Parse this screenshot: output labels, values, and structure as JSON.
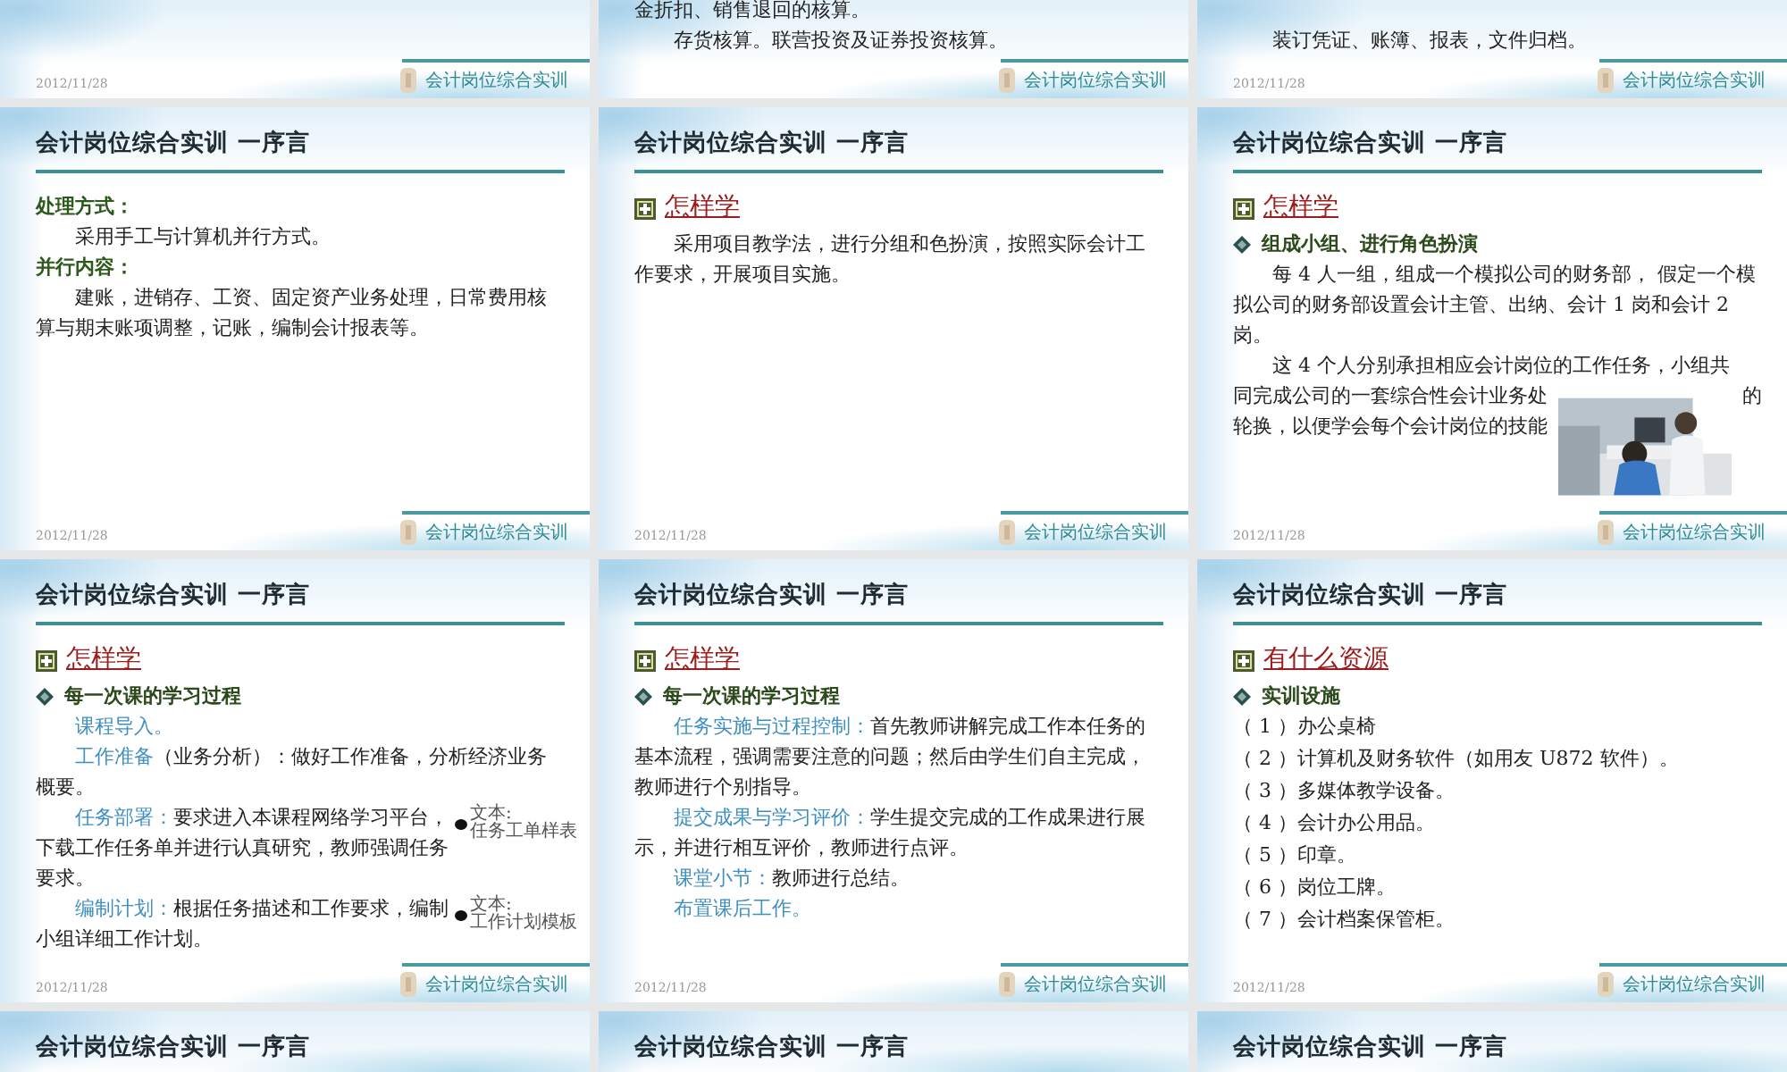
{
  "slides": [
    {
      "kind": "tail",
      "date": "2012/11/28",
      "footer": "会计岗位综合实训"
    },
    {
      "kind": "tail",
      "items": [
        {
          "kind": "para",
          "indent": false,
          "text": "金折扣、销售退回的核算。"
        },
        {
          "kind": "para",
          "indent": true,
          "text": "存货核算。联营投资及证券投资核算。"
        }
      ],
      "footer": "会计岗位综合实训"
    },
    {
      "kind": "tail",
      "items": [
        {
          "kind": "para",
          "indent": true,
          "text": "装订凭证、账簿、报表，文件归档。"
        }
      ],
      "date": "2012/11/28",
      "footer": "会计岗位综合实训"
    },
    {
      "kind": "full",
      "title": "会计岗位综合实训 一序言",
      "items": [
        {
          "kind": "label",
          "text": "处理方式："
        },
        {
          "kind": "para",
          "indent": true,
          "text": "采用手工与计算机并行方式。"
        },
        {
          "kind": "label",
          "text": "并行内容："
        },
        {
          "kind": "para",
          "indent": true,
          "text": "建账，进销存、工资、固定资产业务处理，日常费用核算与期末账项调整，记账，编制会计报表等。"
        }
      ],
      "date": "2012/11/28",
      "footer": "会计岗位综合实训"
    },
    {
      "kind": "full",
      "title": "会计岗位综合实训 一序言",
      "items": [
        {
          "kind": "heading",
          "text": "怎样学"
        },
        {
          "kind": "para",
          "indent": true,
          "text": "采用项目教学法，进行分组和色扮演，按照实际会计工作要求，开展项目实施。"
        }
      ],
      "date": "2012/11/28",
      "footer": "会计岗位综合实训"
    },
    {
      "kind": "full",
      "title": "会计岗位综合实训 一序言",
      "items": [
        {
          "kind": "heading",
          "text": "怎样学"
        },
        {
          "kind": "subheading",
          "text": "组成小组、进行角色扮演"
        },
        {
          "kind": "para",
          "indent": true,
          "text": "每 4 人一组，组成一个模拟公司的财务部， 假定一个模拟公司的财务部设置会计主管、出纳、会计 1 岗和会计 2 岗。"
        },
        {
          "kind": "lines",
          "lines": [
            {
              "indent": true,
              "text": "这 4 个人分别承担相应会计岗位的工作任务，小组共"
            },
            {
              "indent": false,
              "text": "同完成公司的一套综合性会计业务处",
              "tail": "的"
            },
            {
              "indent": false,
              "text": "轮换，以便学会每个会计岗位的技能"
            }
          ]
        }
      ],
      "date": "2012/11/28",
      "footer": "会计岗位综合实训"
    },
    {
      "kind": "full",
      "title": "会计岗位综合实训 一序言",
      "items": [
        {
          "kind": "heading",
          "text": "怎样学"
        },
        {
          "kind": "subheading",
          "text": "每一次课的学习过程"
        },
        {
          "kind": "para",
          "indent": true,
          "label": "课程导入。"
        },
        {
          "kind": "para",
          "indent": true,
          "label": "工作准备",
          "text": "（业务分析）：做好工作准备，分析经济业务概要。"
        },
        {
          "kind": "para",
          "indent": true,
          "label": "任务部署：",
          "text": "要求进入本课程网络学习平台，下载工作任务单并进行认真研究，教师强调任务要求。",
          "attachment": [
            "文本:",
            "任务工单样表"
          ]
        },
        {
          "kind": "para",
          "indent": true,
          "label": "编制计划：",
          "text": "根据任务描述和工作要求，编制小组详细工作计划。",
          "attachment": [
            "文本:",
            "工作计划模板"
          ]
        }
      ],
      "date": "2012/11/28",
      "footer": "会计岗位综合实训"
    },
    {
      "kind": "full",
      "title": "会计岗位综合实训 一序言",
      "items": [
        {
          "kind": "heading",
          "text": "怎样学"
        },
        {
          "kind": "subheading",
          "text": "每一次课的学习过程"
        },
        {
          "kind": "para",
          "indent": true,
          "label": "任务实施与过程控制：",
          "text": "首先教师讲解完成工作本任务的基本流程，强调需要注意的问题；然后由学生们自主完成，教师进行个别指导。"
        },
        {
          "kind": "para",
          "indent": true,
          "label": "提交成果与学习评价：",
          "text": "学生提交完成的工作成果进行展示，并进行相互评价，教师进行点评。"
        },
        {
          "kind": "para",
          "indent": true,
          "label": "课堂小节：",
          "text": "教师进行总结。"
        },
        {
          "kind": "para",
          "indent": true,
          "label": "布置课后工作。"
        }
      ],
      "date": "2012/11/28",
      "footer": "会计岗位综合实训"
    },
    {
      "kind": "full",
      "title": "会计岗位综合实训 一序言",
      "items": [
        {
          "kind": "heading",
          "text": "有什么资源"
        },
        {
          "kind": "subheading",
          "text": "实训设施"
        },
        {
          "kind": "item",
          "text": "（ 1 ）办公桌椅"
        },
        {
          "kind": "item",
          "text": "（ 2 ）计算机及财务软件（如用友 U872 软件）。"
        },
        {
          "kind": "item",
          "text": "（ 3 ）多媒体教学设备。"
        },
        {
          "kind": "item",
          "text": "（ 4 ）会计办公用品。"
        },
        {
          "kind": "item",
          "text": "（ 5 ）印章。"
        },
        {
          "kind": "item",
          "text": "（ 6 ）岗位工牌。"
        },
        {
          "kind": "item",
          "text": "（ 7 ）会计档案保管柜。"
        }
      ],
      "date": "2012/11/28",
      "footer": "会计岗位综合实训"
    },
    {
      "kind": "head",
      "title": "会计岗位综合实训 一序言"
    },
    {
      "kind": "head",
      "title": "会计岗位综合实训 一序言"
    },
    {
      "kind": "head",
      "title": "会计岗位综合实训 一序言"
    }
  ]
}
